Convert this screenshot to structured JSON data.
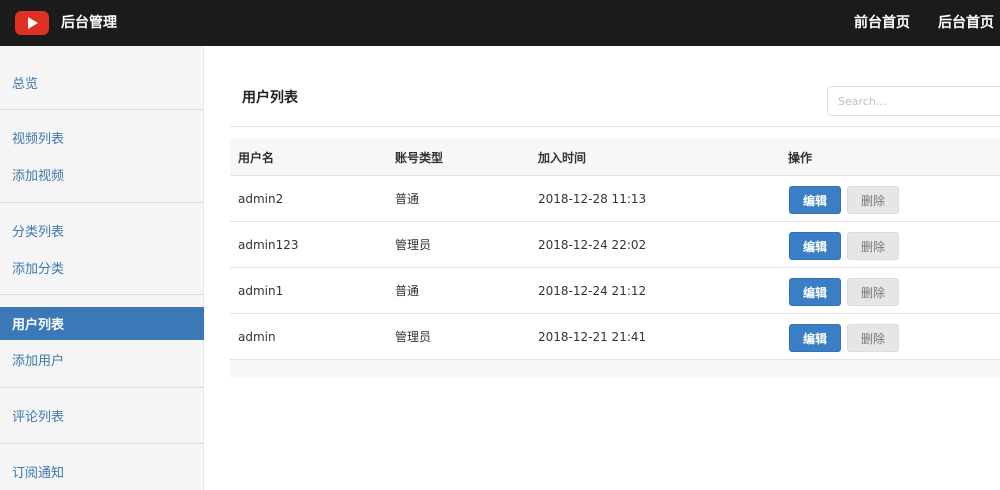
{
  "header": {
    "brand": "后台管理",
    "links": [
      "前台首页",
      "后台首页"
    ],
    "colors": {
      "bar": "#1b1b1b",
      "logo": "#e02f24"
    }
  },
  "sidebar": {
    "items": [
      {
        "label": "总览"
      },
      {
        "label": "视频列表"
      },
      {
        "label": "添加视频"
      },
      {
        "label": "分类列表"
      },
      {
        "label": "添加分类"
      },
      {
        "label": "用户列表",
        "active": true
      },
      {
        "label": "添加用户"
      },
      {
        "label": "评论列表"
      },
      {
        "label": "订阅通知"
      }
    ],
    "active_color": "#3a78b8",
    "link_color": "#3f77b2"
  },
  "main": {
    "title": "用户列表",
    "search": {
      "placeholder": "Search..."
    },
    "table": {
      "headers": [
        "用户名",
        "账号类型",
        "加入时间",
        "操作"
      ],
      "rows": [
        {
          "username": "admin2",
          "type": "普通",
          "joined": "2018-12-28 11:13"
        },
        {
          "username": "admin123",
          "type": "管理员",
          "joined": "2018-12-24 22:02"
        },
        {
          "username": "admin1",
          "type": "普通",
          "joined": "2018-12-24 21:12"
        },
        {
          "username": "admin",
          "type": "管理员",
          "joined": "2018-12-21 21:41"
        }
      ],
      "edit_label": "编辑",
      "delete_label": "删除"
    }
  }
}
